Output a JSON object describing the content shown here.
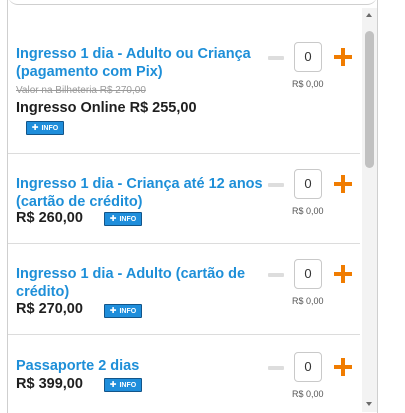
{
  "info_label": "INFO",
  "tickets": [
    {
      "title": "Ingresso 1 dia - Adulto ou Criança (pagamento com Pix)",
      "old_price": "Valor na Bilheteria R$ 270,00",
      "price": "Ingresso Online R$ 255,00",
      "quantity": "0",
      "subtotal": "R$ 0,00"
    },
    {
      "title": "Ingresso 1 dia - Criança até 12 anos (cartão de crédito)",
      "price": "R$ 260,00",
      "quantity": "0",
      "subtotal": "R$ 0,00"
    },
    {
      "title": "Ingresso 1 dia - Adulto (cartão de crédito)",
      "price": "R$ 270,00",
      "quantity": "0",
      "subtotal": "R$ 0,00"
    },
    {
      "title": "Passaporte 2 dias",
      "price": "R$ 399,00",
      "quantity": "0",
      "subtotal": "R$ 0,00"
    }
  ]
}
